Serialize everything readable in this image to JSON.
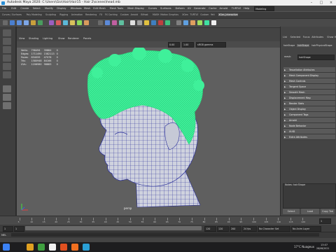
{
  "window": {
    "title": "Autodesk Maya 2020: C:\\Users\\Gio\\Hair\\Hair15 - Hair 2\\scenes\\head.mb",
    "app": "Maya"
  },
  "menu": [
    "File",
    "Edit",
    "Create",
    "Select",
    "Modify",
    "Display",
    "Windows",
    "Mesh",
    "Edit Mesh",
    "Mesh Tools",
    "Mesh Display",
    "Curves",
    "Surfaces",
    "Deform",
    "UV",
    "Generate",
    "Cache",
    "Arnold",
    "TURTLE",
    "Help"
  ],
  "toolbar": {
    "mode": "Modeling",
    "no_live": "No Live Surface",
    "symmetry": "Symmetry: Off",
    "workspace": "Workspace : General"
  },
  "shelf_tabs": [
    "Curves / Surfaces",
    "Poly Modeling",
    "Sculpting",
    "Rigging",
    "Animation",
    "Rendering",
    "FX",
    "FX Caching",
    "Custom",
    "Arnold",
    "Bifrost",
    "MASH",
    "Motion Graphics",
    "XGen",
    "TURTLE",
    "Custom",
    "Yeti",
    "XGen_Interactive"
  ],
  "panel_menu": [
    "View",
    "Shading",
    "Lighting",
    "Show",
    "Renderer",
    "Panels"
  ],
  "view_toolbar": {
    "gamma": "0.00",
    "exposure": "1.00",
    "colorspace": "sRGB gamma"
  },
  "hud": {
    "rows": [
      {
        "label": "Verts:",
        "a": "798494",
        "b": "39884",
        "c": "0"
      },
      {
        "label": "Edges:",
        "a": "1711490",
        "b": "1582113",
        "c": "0"
      },
      {
        "label": "Faces:",
        "a": "834059",
        "b": "47078",
        "c": "0"
      },
      {
        "label": "Tris:",
        "a": "1580948",
        "b": "84166",
        "c": "0"
      },
      {
        "label": "UVs:",
        "a": "1206980",
        "b": "98883",
        "c": "0"
      }
    ]
  },
  "viewport_label": "persp",
  "right_panel": {
    "tabs": [
      "List",
      "Selected",
      "Focus",
      "Attributes",
      "Show",
      "Help"
    ],
    "node_tabs": [
      "hairShape",
      "hairShape",
      "hairPhysicalShape"
    ],
    "shape_label": "mesh:",
    "shape_value": "hairShape",
    "sections": [
      "Tessellation Attributes",
      "Mesh Component Display",
      "Mesh Controls",
      "Tangent Space",
      "Smooth Mesh",
      "Displacement Map",
      "Render Stats",
      "Object Display",
      "Component Tags",
      "Arnold",
      "Node Behavior",
      "UUID",
      "Extra Attributes"
    ],
    "notes_label": "Notes: hairShape",
    "buttons": [
      "Select",
      "Load Attributes",
      "Copy Tab"
    ]
  },
  "timeline": {
    "ticks": [
      "5",
      "10",
      "15",
      "20",
      "25",
      "30",
      "35",
      "40",
      "45",
      "50",
      "55",
      "60",
      "65",
      "70",
      "75",
      "80",
      "85",
      "90",
      "95",
      "100",
      "105",
      "110",
      "115",
      "120"
    ],
    "current": "1"
  },
  "range": {
    "start": "1",
    "start2": "1",
    "end": "120",
    "end2": "120",
    "end3": "200",
    "fps": "24 fps",
    "char_set": "No Character Set",
    "anim_layer": "No Anim Layer"
  },
  "cmd": {
    "lang": "MEL"
  },
  "taskbar": {
    "weather": "17°C Nuageux",
    "time": "13:07",
    "date": "28/08/2021"
  },
  "colors": {
    "hair": "#3ff09a",
    "mesh_wire": "#2a2f9a",
    "viewport_bg": "#5f5f5f"
  }
}
